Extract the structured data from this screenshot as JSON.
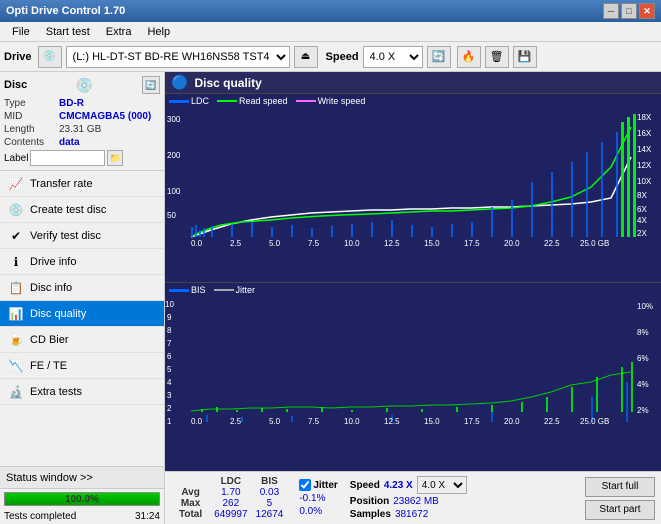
{
  "titleBar": {
    "title": "Opti Drive Control 1.70",
    "controls": [
      "minimize",
      "maximize",
      "close"
    ]
  },
  "menuBar": {
    "items": [
      "File",
      "Start test",
      "Extra",
      "Help"
    ]
  },
  "driveToolbar": {
    "driveLabel": "Drive",
    "driveValue": "(L:)  HL-DT-ST BD-RE  WH16NS58 TST4",
    "speedLabel": "Speed",
    "speedValue": "4.0 X"
  },
  "discInfo": {
    "header": "Disc",
    "type": {
      "label": "Type",
      "value": "BD-R"
    },
    "mid": {
      "label": "MID",
      "value": "CMCMAGBA5 (000)"
    },
    "length": {
      "label": "Length",
      "value": "23.31 GB"
    },
    "contents": {
      "label": "Contents",
      "value": "data"
    },
    "labelField": {
      "label": "Label",
      "value": ""
    }
  },
  "navItems": [
    {
      "id": "transfer-rate",
      "label": "Transfer rate",
      "icon": "📈"
    },
    {
      "id": "create-test-disc",
      "label": "Create test disc",
      "icon": "💿"
    },
    {
      "id": "verify-test-disc",
      "label": "Verify test disc",
      "icon": "✔"
    },
    {
      "id": "drive-info",
      "label": "Drive info",
      "icon": "ℹ"
    },
    {
      "id": "disc-info",
      "label": "Disc info",
      "icon": "📋"
    },
    {
      "id": "disc-quality",
      "label": "Disc quality",
      "icon": "📊",
      "active": true
    },
    {
      "id": "cd-bier",
      "label": "CD Bier",
      "icon": "🍺"
    },
    {
      "id": "fe-te",
      "label": "FE / TE",
      "icon": "📉"
    },
    {
      "id": "extra-tests",
      "label": "Extra tests",
      "icon": "🔬"
    }
  ],
  "statusWindow": {
    "label": "Status window >>"
  },
  "progress": {
    "value": 100,
    "text": "100.0%"
  },
  "statusText": {
    "left": "Tests completed",
    "right": "31:24"
  },
  "chartHeader": {
    "title": "Disc quality",
    "icon": "🔵"
  },
  "topChart": {
    "legend": [
      {
        "label": "LDC",
        "color": "#0000ff"
      },
      {
        "label": "Read speed",
        "color": "#00ff00"
      },
      {
        "label": "Write speed",
        "color": "#ff00ff"
      }
    ],
    "yMax": 300,
    "yLabels": [
      "300",
      "200",
      "100",
      "50"
    ],
    "rightLabels": [
      "18X",
      "16X",
      "14X",
      "12X",
      "10X",
      "8X",
      "6X",
      "4X",
      "2X"
    ],
    "xLabels": [
      "0.0",
      "2.5",
      "5.0",
      "7.5",
      "10.0",
      "12.5",
      "15.0",
      "17.5",
      "20.0",
      "22.5",
      "25.0 GB"
    ]
  },
  "bottomChart": {
    "legend": [
      {
        "label": "BIS",
        "color": "#0000ff"
      },
      {
        "label": "Jitter",
        "color": "#888888"
      }
    ],
    "yMax": 10,
    "yLabels": [
      "10",
      "9",
      "8",
      "7",
      "6",
      "5",
      "4",
      "3",
      "2",
      "1"
    ],
    "rightLabels": [
      "10%",
      "8%",
      "6%",
      "4%",
      "2%"
    ],
    "xLabels": [
      "0.0",
      "2.5",
      "5.0",
      "7.5",
      "10.0",
      "12.5",
      "15.0",
      "17.5",
      "20.0",
      "22.5",
      "25.0 GB"
    ]
  },
  "stats": {
    "headers": [
      "",
      "LDC",
      "BIS",
      "",
      "Jitter",
      "Speed",
      ""
    ],
    "avg": {
      "label": "Avg",
      "ldc": "1.70",
      "bis": "0.03",
      "jitter": "-0.1%"
    },
    "max": {
      "label": "Max",
      "ldc": "262",
      "bis": "5",
      "jitter": "0.0%"
    },
    "total": {
      "label": "Total",
      "ldc": "649997",
      "bis": "12674"
    }
  },
  "speedInfo": {
    "speedLabel": "Speed",
    "speedValue": "4.23 X",
    "speedSelect": "4.0 X",
    "positionLabel": "Position",
    "positionValue": "23862 MB",
    "samplesLabel": "Samples",
    "samplesValue": "381672"
  },
  "buttons": {
    "startFull": "Start full",
    "startPart": "Start part"
  },
  "jitter": {
    "checked": true,
    "label": "Jitter"
  }
}
